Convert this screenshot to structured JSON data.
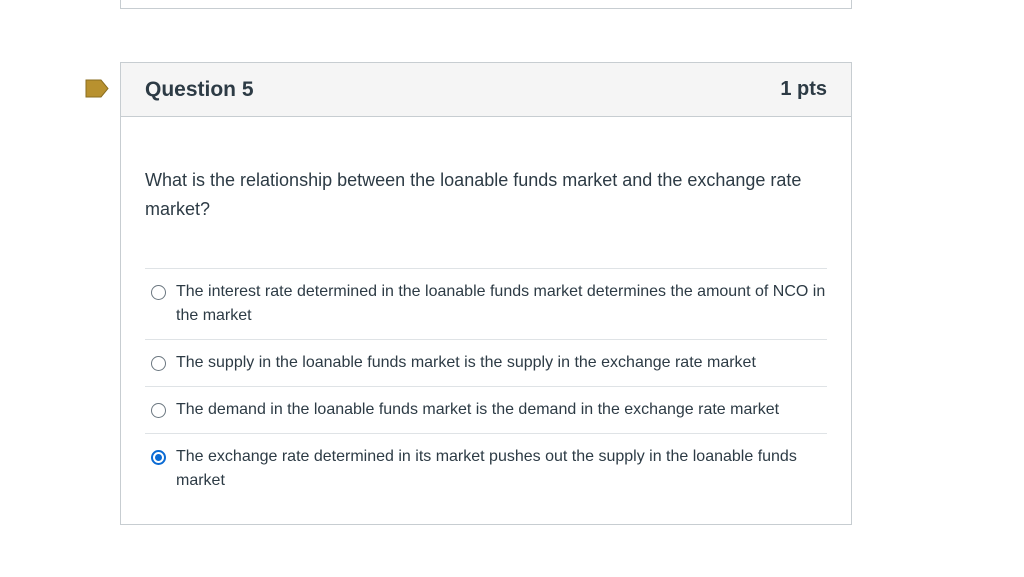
{
  "question": {
    "title": "Question 5",
    "points": "1 pts",
    "text": "What is the relationship between the loanable funds market and the exchange rate market?",
    "flag_color": "#b8912f",
    "answers": [
      {
        "label": "The interest rate determined in the loanable funds market determines the amount of NCO in the market",
        "selected": false
      },
      {
        "label": "The supply in the loanable funds market is the supply in the exchange rate market",
        "selected": false
      },
      {
        "label": "The demand in the loanable funds market is the demand in the exchange rate market",
        "selected": false
      },
      {
        "label": "The exchange rate determined in its market pushes out the supply in the loanable funds market",
        "selected": true
      }
    ]
  }
}
